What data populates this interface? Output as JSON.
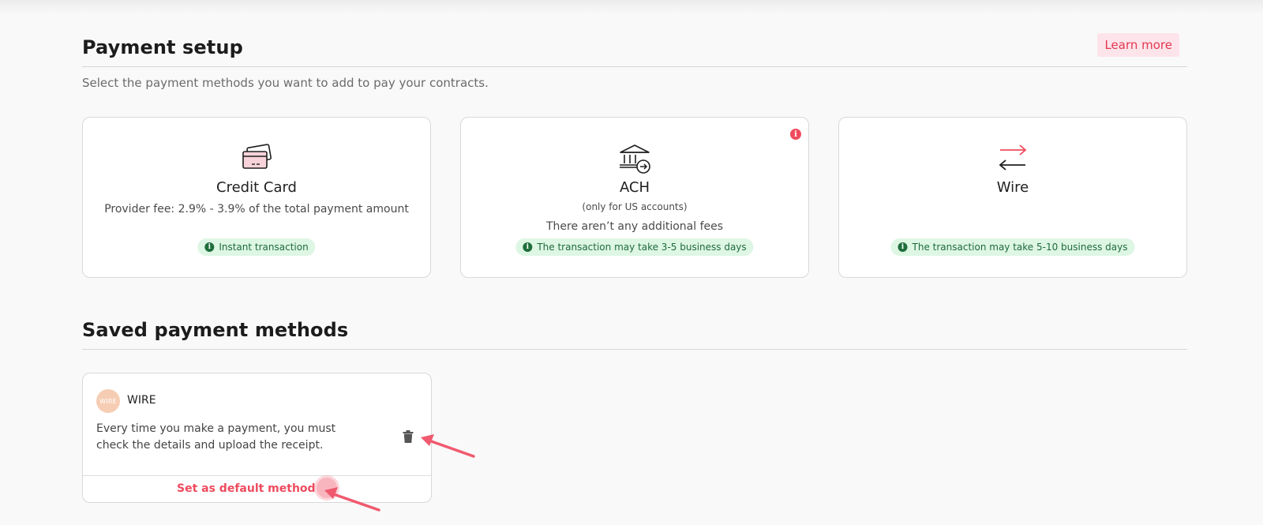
{
  "payment_setup": {
    "title": "Payment setup",
    "learn_more_label": "Learn more",
    "subtitle": "Select the payment methods you want to add to pay your contracts."
  },
  "methods": [
    {
      "name": "Credit Card",
      "line1": "Provider fee: 2.9% - 3.9% of the total payment amount",
      "badge": "Instant transaction",
      "icon": "credit-card-icon"
    },
    {
      "name": "ACH",
      "line1": "(only for US accounts)",
      "line2": "There aren’t any additional fees",
      "badge": "The transaction may take 3-5 business days",
      "icon": "bank-icon",
      "alert_icon": "info-alert-icon"
    },
    {
      "name": "Wire",
      "badge": "The transaction may take 5-10 business days",
      "icon": "transfer-arrows-icon"
    }
  ],
  "saved_methods": {
    "title": "Saved payment methods",
    "items": [
      {
        "avatar_text": "WIRE",
        "name": "WIRE",
        "description": "Every time you make a payment, you must check the details and upload the receipt.",
        "default_label": "Set as default method",
        "delete_icon": "trash-icon"
      }
    ]
  },
  "badge_icon_glyph": "i",
  "colors": {
    "accent": "#ee4b5f",
    "badge_bg": "#def6e4",
    "badge_text": "#1e6b3b",
    "learn_more_bg": "#fde4ea"
  }
}
